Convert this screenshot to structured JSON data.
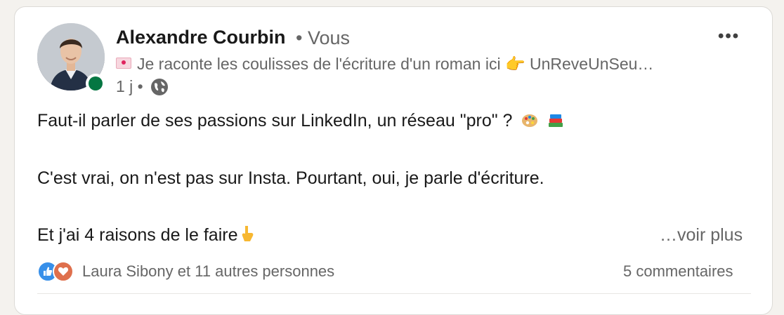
{
  "author": {
    "name": "Alexandre Courbin",
    "relation": "• Vous",
    "headline": "Je raconte les coulisses de l'écriture d'un roman ici 👉 UnReveUnSeu…",
    "time": "1 j •"
  },
  "post": {
    "line1": "Faut-il parler de ses passions sur LinkedIn, un réseau \"pro\" ?",
    "line2": "C'est vrai, on n'est pas sur Insta. Pourtant, oui, je parle d'écriture.",
    "line3": "Et j'ai 4 raisons de le faire",
    "see_more": "…voir plus"
  },
  "social": {
    "reactions_text": "Laura Sibony et 11 autres personnes",
    "comments_text": "5 commentaires"
  },
  "colors": {
    "presence": "#057642",
    "like": "#378fe9",
    "love": "#df704d"
  },
  "icons": {
    "more": "more-icon",
    "globe": "globe-icon",
    "envelope": "love-letter-icon"
  }
}
